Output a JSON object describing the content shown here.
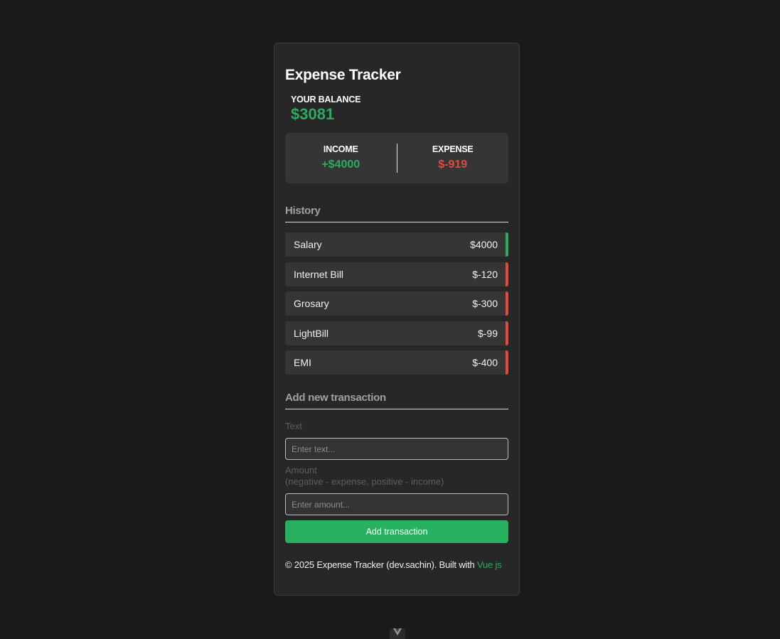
{
  "app": {
    "title": "Expense Tracker"
  },
  "balance": {
    "label": "YOUR BALANCE",
    "value": "$3081"
  },
  "summary": {
    "income_label": "INCOME",
    "income_value": "+$4000",
    "expense_label": "EXPENSE",
    "expense_value": "$-919"
  },
  "history": {
    "title": "History",
    "items": [
      {
        "text": "Salary",
        "amount": "$4000",
        "type": "income"
      },
      {
        "text": "Internet Bill",
        "amount": "$-120",
        "type": "expense"
      },
      {
        "text": "Grosary",
        "amount": "$-300",
        "type": "expense"
      },
      {
        "text": "LightBill",
        "amount": "$-99",
        "type": "expense"
      },
      {
        "text": "EMI",
        "amount": "$-400",
        "type": "expense"
      }
    ]
  },
  "form": {
    "title": "Add new transaction",
    "text_label": "Text",
    "text_placeholder": "Enter text...",
    "text_value": "",
    "amount_label": "Amount",
    "amount_hint": "(negative - expense, positive - income)",
    "amount_placeholder": "Enter amount...",
    "amount_value": "",
    "submit_label": "Add transaction"
  },
  "footer": {
    "text": "© 2025 Expense Tracker (dev.sachin). Built with",
    "link_label": "Vue js"
  },
  "colors": {
    "background": "#1a1a1a",
    "card": "#272727",
    "income_green": "#2eaa5e",
    "expense_red": "#e04b3c",
    "button_green": "#28b061"
  },
  "devtools": {
    "icon": "vue-logo-icon"
  }
}
